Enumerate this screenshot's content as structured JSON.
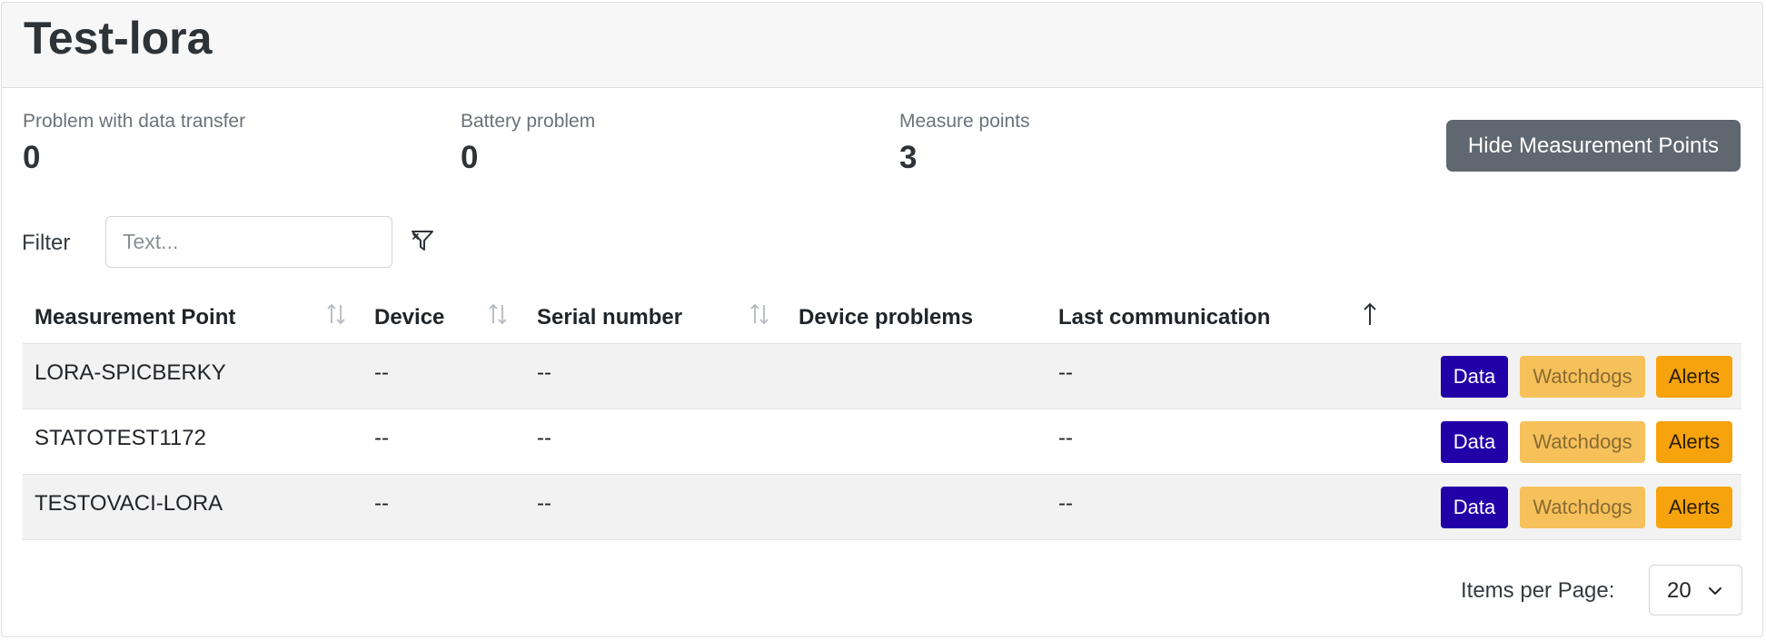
{
  "header": {
    "title": "Test-lora"
  },
  "stats": [
    {
      "label": "Problem with data transfer",
      "value": "0"
    },
    {
      "label": "Battery problem",
      "value": "0"
    },
    {
      "label": "Measure points",
      "value": "3"
    }
  ],
  "hide_button_label": "Hide Measurement Points",
  "filter": {
    "label": "Filter",
    "placeholder": "Text...",
    "value": "",
    "icon": "filter-icon"
  },
  "table": {
    "columns": [
      {
        "label": "Measurement Point",
        "sort": "none"
      },
      {
        "label": "Device",
        "sort": "none"
      },
      {
        "label": "Serial number",
        "sort": "none"
      },
      {
        "label": "Device problems"
      },
      {
        "label": "Last communication",
        "sort": "ascending"
      }
    ],
    "rows": [
      {
        "measurement_point": "LORA-SPICBERKY",
        "device": "--",
        "serial": "--",
        "problems": "",
        "last_comm": "--"
      },
      {
        "measurement_point": "STATOTEST1172",
        "device": "--",
        "serial": "--",
        "problems": "",
        "last_comm": "--"
      },
      {
        "measurement_point": "TESTOVACI-LORA",
        "device": "--",
        "serial": "--",
        "problems": "",
        "last_comm": "--"
      }
    ],
    "actions": {
      "data": "Data",
      "watchdogs": "Watchdogs",
      "alerts": "Alerts"
    }
  },
  "pagination": {
    "label": "Items per Page:",
    "value": "20"
  },
  "colors": {
    "data_button": "#2200a8",
    "watchdogs_button": "#f6c15a",
    "alerts_button": "#f6a30e",
    "hide_button": "#5f6770",
    "header_bg": "#f7f7f8",
    "stripe": "#f2f2f2"
  }
}
